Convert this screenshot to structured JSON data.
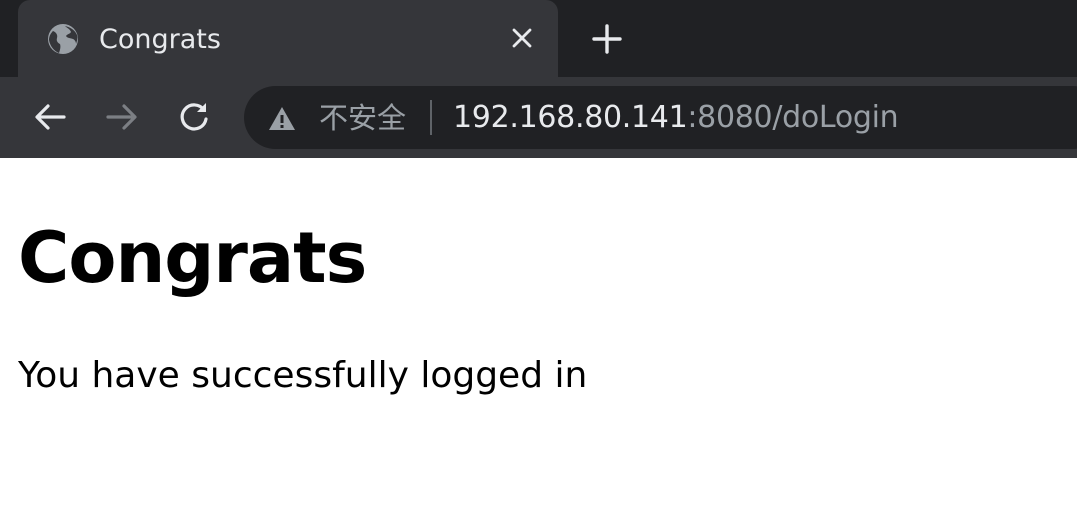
{
  "browser": {
    "tab": {
      "title": "Congrats",
      "favicon": "globe-icon",
      "close_icon": "close-icon"
    },
    "new_tab_icon": "plus-icon",
    "toolbar": {
      "back_icon": "arrow-left-icon",
      "forward_icon": "arrow-right-icon",
      "reload_icon": "reload-icon"
    },
    "omnibox": {
      "security_icon": "warning-icon",
      "security_label": "不安全",
      "url_host": "192.168.80.141",
      "url_rest": ":8080/doLogin"
    },
    "colors": {
      "tabstrip": "#202124",
      "active_tab": "#35363a",
      "omnibox": "#202124",
      "text_primary": "#e8eaed",
      "text_secondary": "#9aa0a6"
    }
  },
  "page": {
    "heading": "Congrats",
    "message": "You have successfully logged in"
  }
}
